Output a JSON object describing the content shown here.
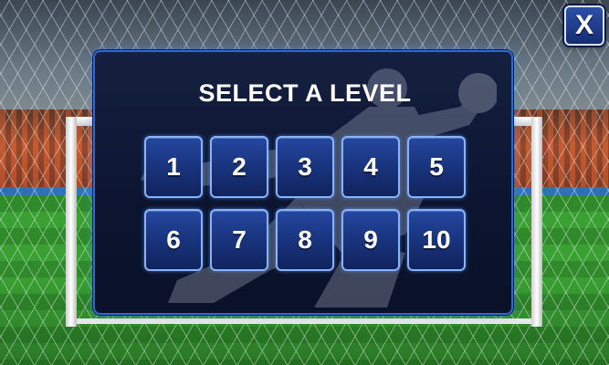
{
  "close_button": {
    "label": "X",
    "icon": "close-icon"
  },
  "panel": {
    "title": "SELECT A LEVEL",
    "levels": [
      "1",
      "2",
      "3",
      "4",
      "5",
      "6",
      "7",
      "8",
      "9",
      "10"
    ]
  },
  "colors": {
    "panel_border": "#2b6ad4",
    "button_top": "#2447a0",
    "button_bottom": "#10245c",
    "button_border": "#86b3ff"
  }
}
